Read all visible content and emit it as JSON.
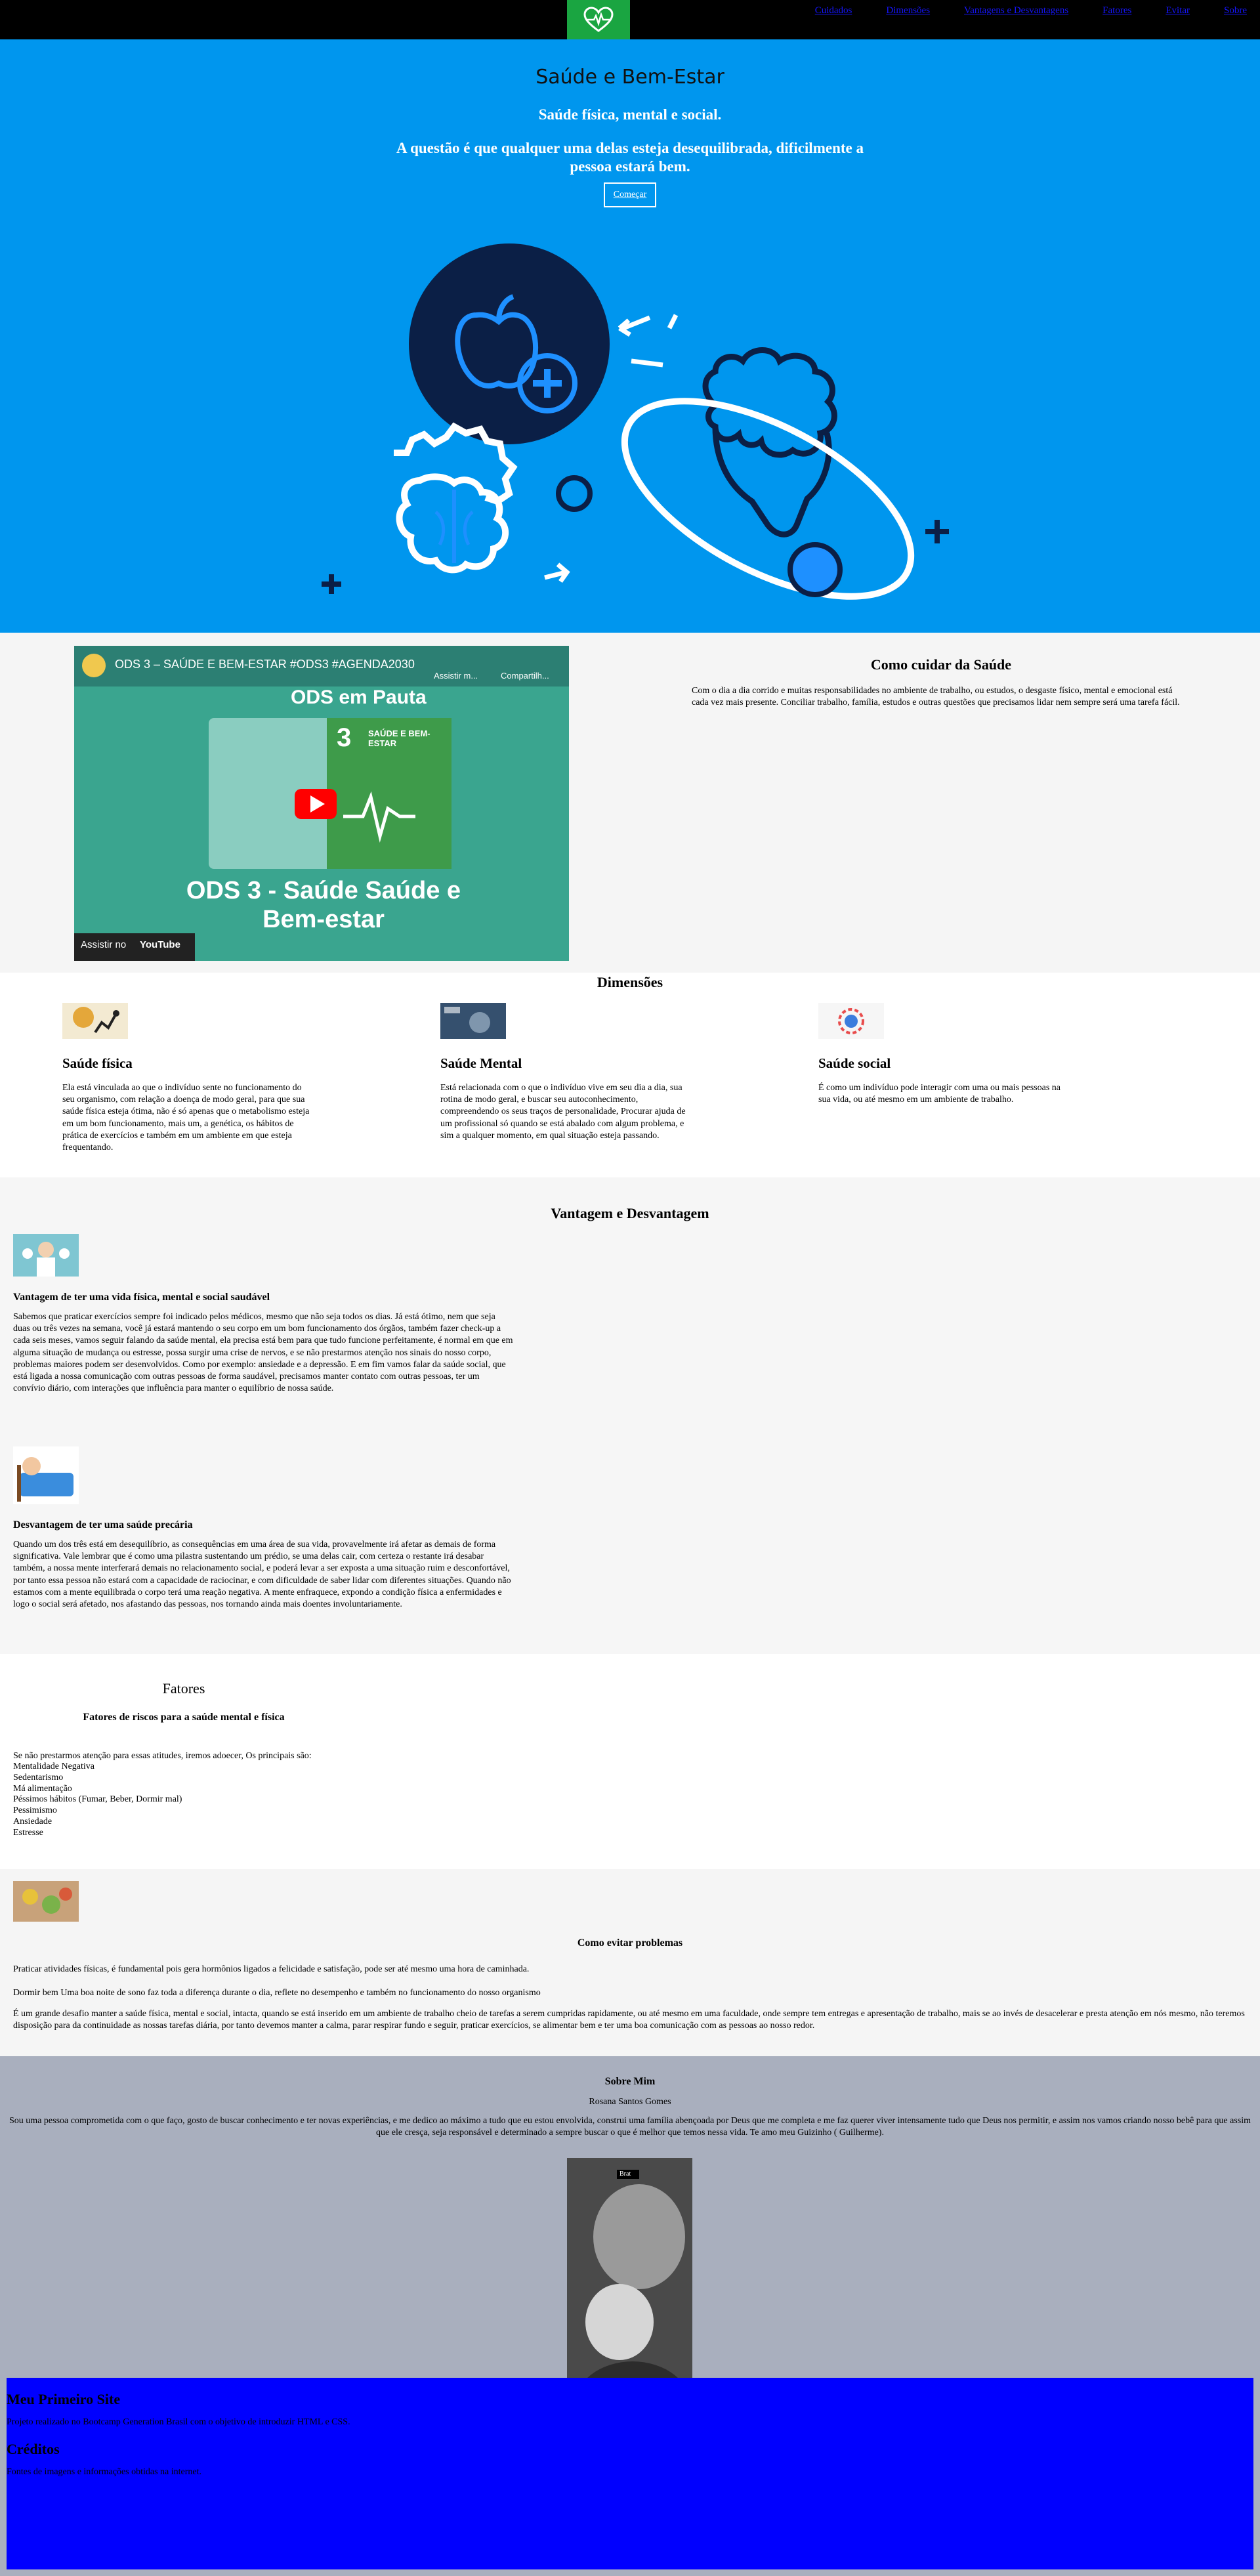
{
  "nav": {
    "links": [
      "Cuidados",
      "Dimensões",
      "Vantagens e Desvantagens",
      "Fatores",
      "Evitar",
      "Sobre"
    ]
  },
  "hero": {
    "title": "Saúde e Bem-Estar",
    "subtitle": "Saúde física, mental e social.",
    "question": "A questão é que qualquer uma delas esteja desequilibrada, dificilmente a pessoa estará bem.",
    "button": "Começar"
  },
  "video": {
    "title": "ODS 3 – SAÚDE E BEM-ESTAR #ODS3 #AGENDA2030",
    "watch_later": "Assistir m...",
    "share": "Compartilh...",
    "banner": "ODS em Pauta",
    "card_number": "3",
    "card_text": "SAÚDE E BEM-ESTAR",
    "caption": "ODS 3 - Saúde Saúde e Bem-estar",
    "watch_on": "Assistir no",
    "youtube": "YouTube"
  },
  "care": {
    "title": "Como cuidar da Saúde",
    "text": "Com o dia a dia corrido e muitas responsabilidades no ambiente de trabalho, ou estudos, o desgaste físico, mental e emocional está cada vez mais presente. Conciliar trabalho, família, estudos e outras questões que precisamos lidar nem sempre será uma tarefa fácil."
  },
  "dimensions": {
    "title": "Dimensões",
    "items": [
      {
        "title": "Saúde física",
        "text": "Ela está vinculada ao que o indivíduo sente no funcionamento do seu organismo, com relação a doença de modo geral, para que sua saúde física esteja ótima, não é só apenas que o metabolismo esteja em um bom funcionamento, mais um, a genética, os hábitos de prática de exercícios e também em um ambiente em que esteja frequentando."
      },
      {
        "title": "Saúde Mental",
        "text": "Está relacionada com o que o indivíduo vive em seu dia a dia, sua rotina de modo geral, e buscar seu autoconhecimento, compreendendo os seus traços de personalidade, Procurar ajuda de um profissional só quando se está abalado com algum problema, e sim a qualquer momento, em qual situação esteja passando."
      },
      {
        "title": "Saúde social",
        "text": "É como um indivíduo pode interagir com uma ou mais pessoas na sua vida, ou até mesmo em um ambiente de trabalho."
      }
    ]
  },
  "advantages": {
    "title": "Vantagem e Desvantagem",
    "adv_title": "Vantagem de ter uma vida física, mental e social saudável",
    "adv_text": "Sabemos que praticar exercícios sempre foi indicado pelos médicos, mesmo que não seja todos os dias. Já está ótimo, nem que seja duas ou três vezes na semana, você já estará mantendo o seu corpo em um bom funcionamento dos órgãos, também fazer check-up a cada seis meses, vamos seguir falando da saúde mental, ela precisa está bem para que tudo funcione perfeitamente, é normal em que em alguma situação de mudança ou estresse, possa surgir uma crise de nervos, e se não prestarmos atenção nos sinais do nosso corpo, problemas maiores podem ser desenvolvidos. Como por exemplo: ansiedade e a depressão. E em fim vamos falar da saúde social, que está ligada a nossa comunicação com outras pessoas de forma saudável, precisamos manter contato com outras pessoas, ter um convívio diário, com interações que influência para manter o equilíbrio de nossa saúde.",
    "dis_title": "Desvantagem de ter uma saúde precária",
    "dis_text": "Quando um dos três está em desequilíbrio, as consequências em uma área de sua vida, provavelmente irá afetar as demais de forma significativa. Vale lembrar que é como uma pilastra sustentando um prédio, se uma delas cair, com certeza o restante irá desabar também, a nossa mente interferará demais no relacionamento social, e poderá levar a ser exposta a uma situação ruim e desconfortável, por tanto essa pessoa não estará com a capacidade de raciocinar, e com dificuldade de saber lidar com diferentes situações. Quando não estamos com a mente equilibrada o corpo terá uma reação negativa. A mente enfraquece, expondo a condição física a enfermidades e logo o social será afetado, nos afastando das pessoas, nos tornando ainda mais doentes involuntariamente."
  },
  "factors": {
    "title": "Fatores",
    "subtitle": "Fatores de riscos para a saúde mental e física",
    "intro": "Se não prestarmos atenção para essas atitudes, iremos adoecer, Os principais são:",
    "items": [
      "Mentalidade Negativa",
      "Sedentarismo",
      "Má alimentação",
      "Péssimos hábitos (Fumar, Beber, Dormir mal)",
      "Pessimismo",
      "Ansiedade",
      "Estresse"
    ]
  },
  "avoid": {
    "title": "Como evitar problemas",
    "p1": "Praticar atividades físicas, é fundamental pois gera hormônios ligados a felicidade e satisfação, pode ser até mesmo uma hora de caminhada.",
    "p2": "Dormir bem Uma boa noite de sono faz toda a diferença durante o dia, reflete no desempenho e também no funcionamento do nosso organismo",
    "p3": "É um grande desafio manter a saúde física, mental e social, intacta, quando se está inserido em um ambiente de trabalho cheio de tarefas a serem cumpridas rapidamente, ou até mesmo em uma faculdade, onde sempre tem entregas e apresentação de trabalho, mais se ao invés de desacelerar e presta atenção em nós mesmo, não teremos disposição para da continuidade as nossas tarefas diária, por tanto devemos manter a calma, parar respirar fundo e seguir, praticar exercícios, se alimentar bem e ter uma boa comunicação com as pessoas ao nosso redor."
  },
  "about": {
    "title": "Sobre Mim",
    "name": "Rosana Santos Gomes",
    "bio": "Sou uma pessoa comprometida com o que faço, gosto de buscar conhecimento e ter novas experiências, e me dedico ao máximo a tudo que eu estou envolvida, construi uma família abençoada por Deus que me completa e me faz querer viver intensamente tudo que Deus nos permitir, e assim nos vamos criando nosso bebê para que assim que ele cresça, seja responsável e determinado a sempre buscar o que é melhor que temos nessa vida. Te amo meu Guizinho ( Guilherme).",
    "photo_badge": "Brat"
  },
  "footer": {
    "h1": "Meu Primeiro Site",
    "p1": "Projeto realizado no Bootcamp Generation Brasil com o objetivo de introduzir HTML e CSS.",
    "h2": "Créditos",
    "p2": "Fontes de imagens e informações obtidas na internet."
  }
}
